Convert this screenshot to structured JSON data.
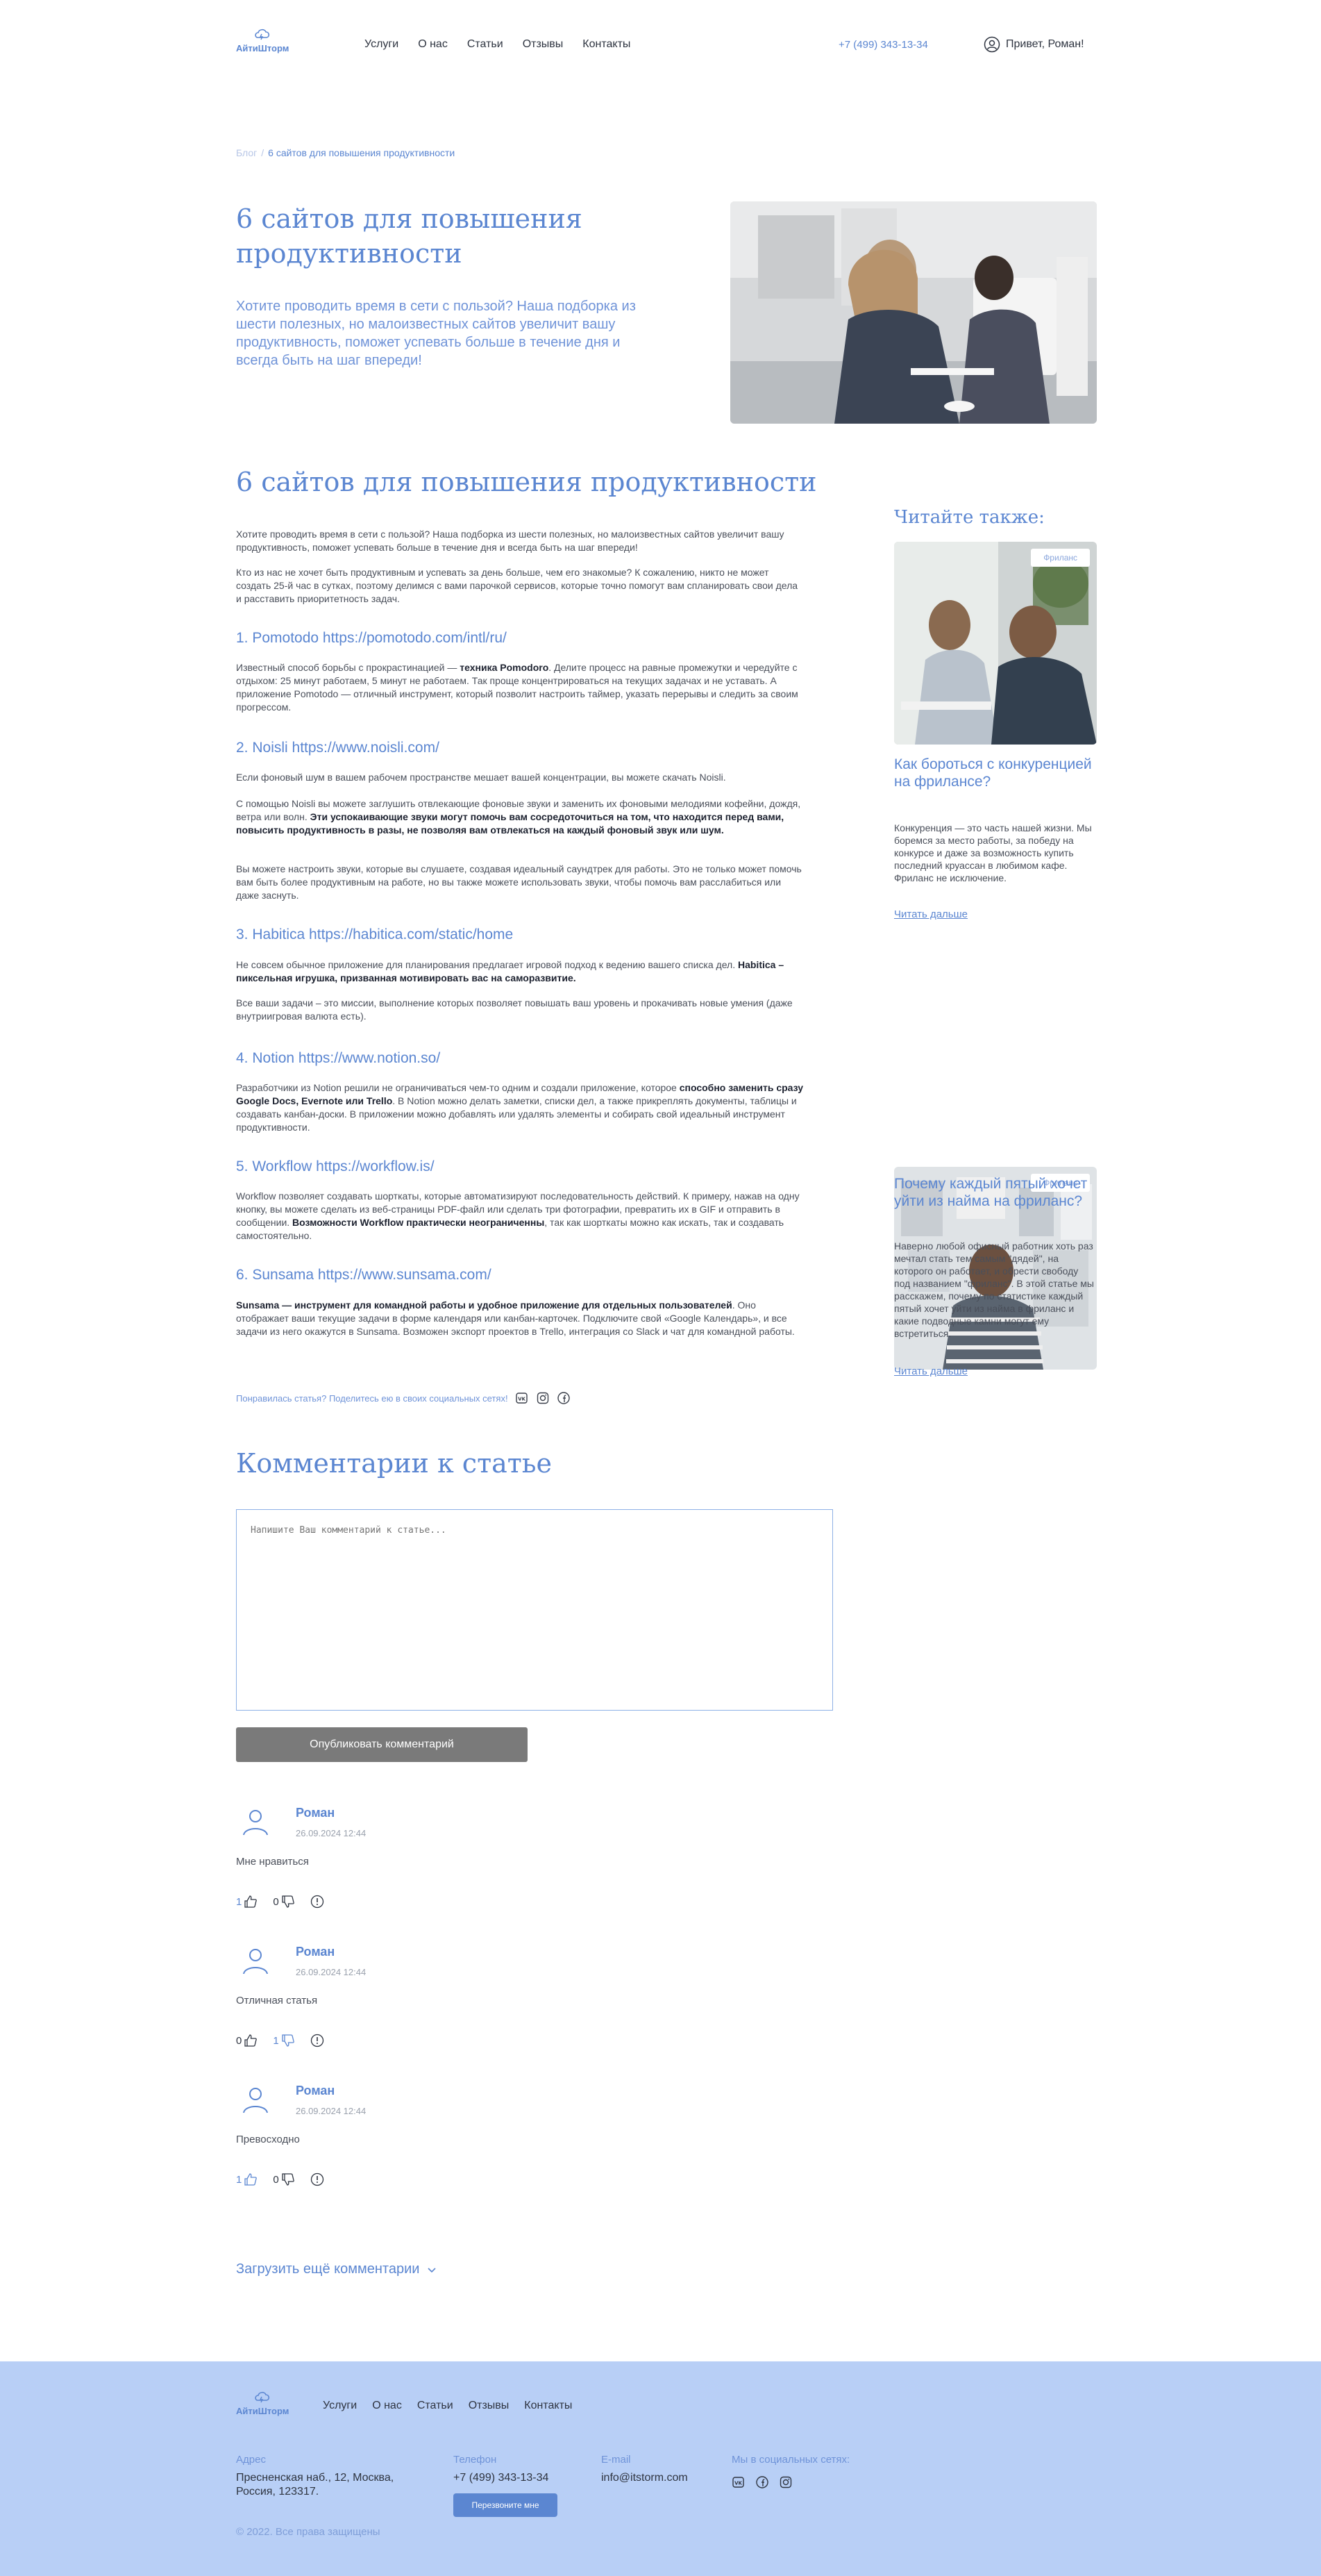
{
  "header": {
    "logo_text": "АйтиШторм",
    "nav": [
      "Услуги",
      "О нас",
      "Статьи",
      "Отзывы",
      "Контакты"
    ],
    "phone": "+7 (499) 343-13-34",
    "greeting": "Привет, Роман!"
  },
  "breadcrumb": {
    "root": "Блог",
    "current": "6 сайтов для повышения продуктивности"
  },
  "hero": {
    "title": "6 сайтов для повышения продуктивности",
    "lead": "Хотите проводить время в сети с пользой? Наша подборка из шести полезных, но малоизвестных сайтов увеличит вашу продуктивность, поможет успевать больше в течение дня и всегда быть на шаг впереди!"
  },
  "article": {
    "title": "6 сайтов для повышения продуктивности",
    "intro1": "Хотите проводить время в сети с пользой? Наша подборка из шести полезных, но малоизвестных сайтов увеличит вашу продуктивность, поможет успевать больше в течение дня и всегда быть на шаг впереди!",
    "intro2": "Кто из нас не хочет быть продуктивным и успевать за день больше, чем его знакомые? К сожалению, никто не может создать 25-й час в сутках, поэтому делимся с вами парочкой сервисов, которые точно помогут вам спланировать свои дела и расставить приоритетность задач.",
    "s1_title": "1. Pomotodo https://pomotodo.com/intl/ru/",
    "s1_a": "Известный способ борьбы с прокрастинацией — ",
    "s1_b": "техника Pomodoro",
    "s1_c": ". Делите процесс на равные промежутки и чередуйте с отдыхом: 25 минут работаем, 5 минут не работаем. Так проще концентрироваться на текущих задачах и не уставать. А приложение Pomotodo — отличный инструмент, который позволит настроить таймер, указать перерывы и следить за своим прогрессом.",
    "s2_title": "2. Noisli https://www.noisli.com/",
    "s2_p1": "Если фоновый шум в вашем рабочем пространстве мешает вашей концентрации, вы можете скачать Noisli.",
    "s2_p2a": "С помощью Noisli вы можете заглушить отвлекающие фоновые звуки и заменить их фоновыми мелодиями кофейни, дождя, ветра или волн. ",
    "s2_p2b": "Эти успокаивающие звуки могут помочь вам сосредоточиться на том, что находится перед вами, повысить продуктивность в разы, не позволяя вам отвлекаться на каждый фоновый звук или шум.",
    "s2_p3": "Вы можете настроить звуки, которые вы слушаете, создавая идеальный саундтрек для работы. Это не только может помочь вам быть более продуктивным на работе, но вы также можете использовать звуки, чтобы помочь вам расслабиться или даже заснуть.",
    "s3_title": "3. Habitica https://habitica.com/static/home",
    "s3_p1a": "Не совсем обычное приложение для планирования предлагает игровой подход к ведению вашего списка дел. ",
    "s3_p1b": "Habitica – пиксельная игрушка, призванная мотивировать вас на саморазвитие.",
    "s3_p2": "Все ваши задачи – это миссии, выполнение которых позволяет повышать ваш уровень и прокачивать новые умения (даже внутриигровая валюта есть).",
    "s4_title": "4. Notion https://www.notion.so/",
    "s4_a": "Разработчики из Notion решили не ограничиваться чем-то одним и создали приложение, которое ",
    "s4_b": "способно заменить сразу Google Docs, Evernote или Trello",
    "s4_c": ". В Notion можно делать заметки, списки дел, а также прикреплять документы, таблицы и создавать канбан-доски. В приложении можно добавлять или удалять элементы и собирать свой идеальный инструмент продуктивности.",
    "s5_title": "5. Workflow https://workflow.is/",
    "s5_a": "Workflow позволяет создавать шорткаты, которые автоматизируют последовательность действий. К примеру, нажав на одну кнопку, вы можете сделать из веб-страницы PDF-файл или сделать три фотографии, превратить их в GIF и отправить в сообщении. ",
    "s5_b": "Возможности Workflow практически неограниченны",
    "s5_c": ", так как шорткаты можно как искать, так и создавать самостоятельно.",
    "s6_title": "6. Sunsama https://www.sunsama.com/",
    "s6_a": "Sunsama — инструмент для командной работы и удобное приложение для отдельных пользователей",
    "s6_b": ". Оно отображает ваши текущие задачи в форме календаря или канбан-карточек. Подключите свой «Google Календарь», и все задачи из него окажутся в Sunsama. Возможен экспорт проектов в Trello, интеграция со Slack и чат для командной работы."
  },
  "share": {
    "text": "Понравилась статья? Поделитесь ею в своих социальных сетях!",
    "icons": [
      "vk-icon",
      "instagram-icon",
      "facebook-icon"
    ]
  },
  "sidebar": {
    "title": "Читайте также:",
    "cards": [
      {
        "tag": "Фриланс",
        "title": "Как бороться с конкуренцией на фрилансе?",
        "text": "Конкуренция — это часть нашей жизни. Мы боремся за место работы, за победу на конкурсе и даже за возможность купить последний круассан в любимом кафе. Фриланс не исключение.",
        "link": "Читать дальше"
      },
      {
        "tag": "Фриланс",
        "title": "Почему каждый пятый хочет уйти из найма на фриланс?",
        "text": "Наверно любой офисный работник хоть раз мечтал стать тем самым \"дядей\", на которого он работает, и обрести свободу под названием \"фриланс\". В этой статье мы расскажем, почему по статистике каждый пятый хочет уйти из найма в фриланс и какие подводные камни могут ему встретиться.",
        "link": "Читать дальше"
      }
    ]
  },
  "comments": {
    "title": "Комментарии к статье",
    "placeholder": "Напишите Ваш комментарий к статье...",
    "publish": "Опубликовать комментарий",
    "items": [
      {
        "name": "Роман",
        "date": "26.09.2024 12:44",
        "text": "Мне нравиться",
        "likes": "1",
        "dislikes": "0"
      },
      {
        "name": "Роман",
        "date": "26.09.2024 12:44",
        "text": "Отличная статья",
        "likes": "0",
        "dislikes": "1"
      },
      {
        "name": "Роман",
        "date": "26.09.2024 12:44",
        "text": "Превосходно",
        "likes": "1",
        "dislikes": "0"
      }
    ],
    "load_more": "Загрузить ещё комментарии"
  },
  "footer": {
    "logo_text": "АйтиШторм",
    "nav": [
      "Услуги",
      "О нас",
      "Статьи",
      "Отзывы",
      "Контакты"
    ],
    "address_label": "Адрес",
    "address": "Пресненская наб., 12, Москва, Россия, 123317.",
    "phone_label": "Телефон",
    "phone": "+7 (499) 343-13-34",
    "callback": "Перезвоните мне",
    "email_label": "E-mail",
    "email": "info@itstorm.com",
    "social_label": "Мы в социальных сетях:",
    "copyright": "© 2022. Все права защищены"
  },
  "colors": {
    "accent": "#5b86d1",
    "footer_bg": "#b8cff6",
    "button_gray": "#7a7a7a"
  }
}
